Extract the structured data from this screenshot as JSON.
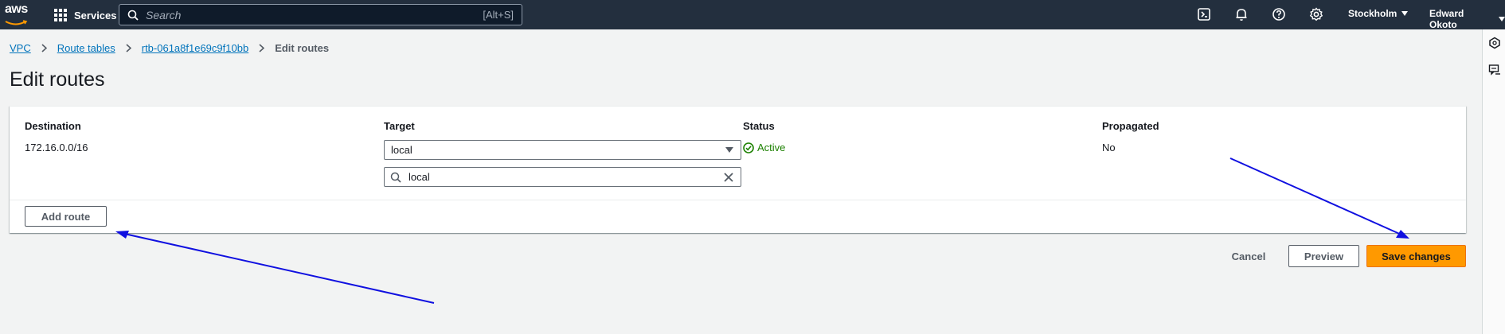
{
  "topnav": {
    "logo_text": "aws",
    "services_label": "Services",
    "search_placeholder": "Search",
    "search_shortcut": "[Alt+S]",
    "icons": [
      "cloudshell-icon",
      "bell-icon",
      "help-icon",
      "gear-icon"
    ],
    "region_label": "Stockholm",
    "user_label": "Edward Okoto"
  },
  "breadcrumb": {
    "items": [
      "VPC",
      "Route tables",
      "rtb-061a8f1e69c9f10bb"
    ],
    "current": "Edit routes"
  },
  "page": {
    "title": "Edit routes"
  },
  "routes_table": {
    "columns": [
      "Destination",
      "Target",
      "Status",
      "Propagated"
    ],
    "rows": [
      {
        "destination": "172.16.0.0/16",
        "target": "local",
        "target_filter": "local",
        "status": "Active",
        "propagated": "No"
      }
    ],
    "add_route_label": "Add route"
  },
  "actions": {
    "cancel_label": "Cancel",
    "preview_label": "Preview",
    "save_label": "Save changes"
  },
  "colors": {
    "nav_bg": "#232f3e",
    "page_bg": "#f2f3f3",
    "link": "#0073bb",
    "status_ok": "#1d8102",
    "primary": "#ff9900",
    "annotation_arrow": "#1010e0"
  },
  "right_rail": {
    "icons": [
      "info-hexagon-icon",
      "feedback-icon"
    ]
  }
}
